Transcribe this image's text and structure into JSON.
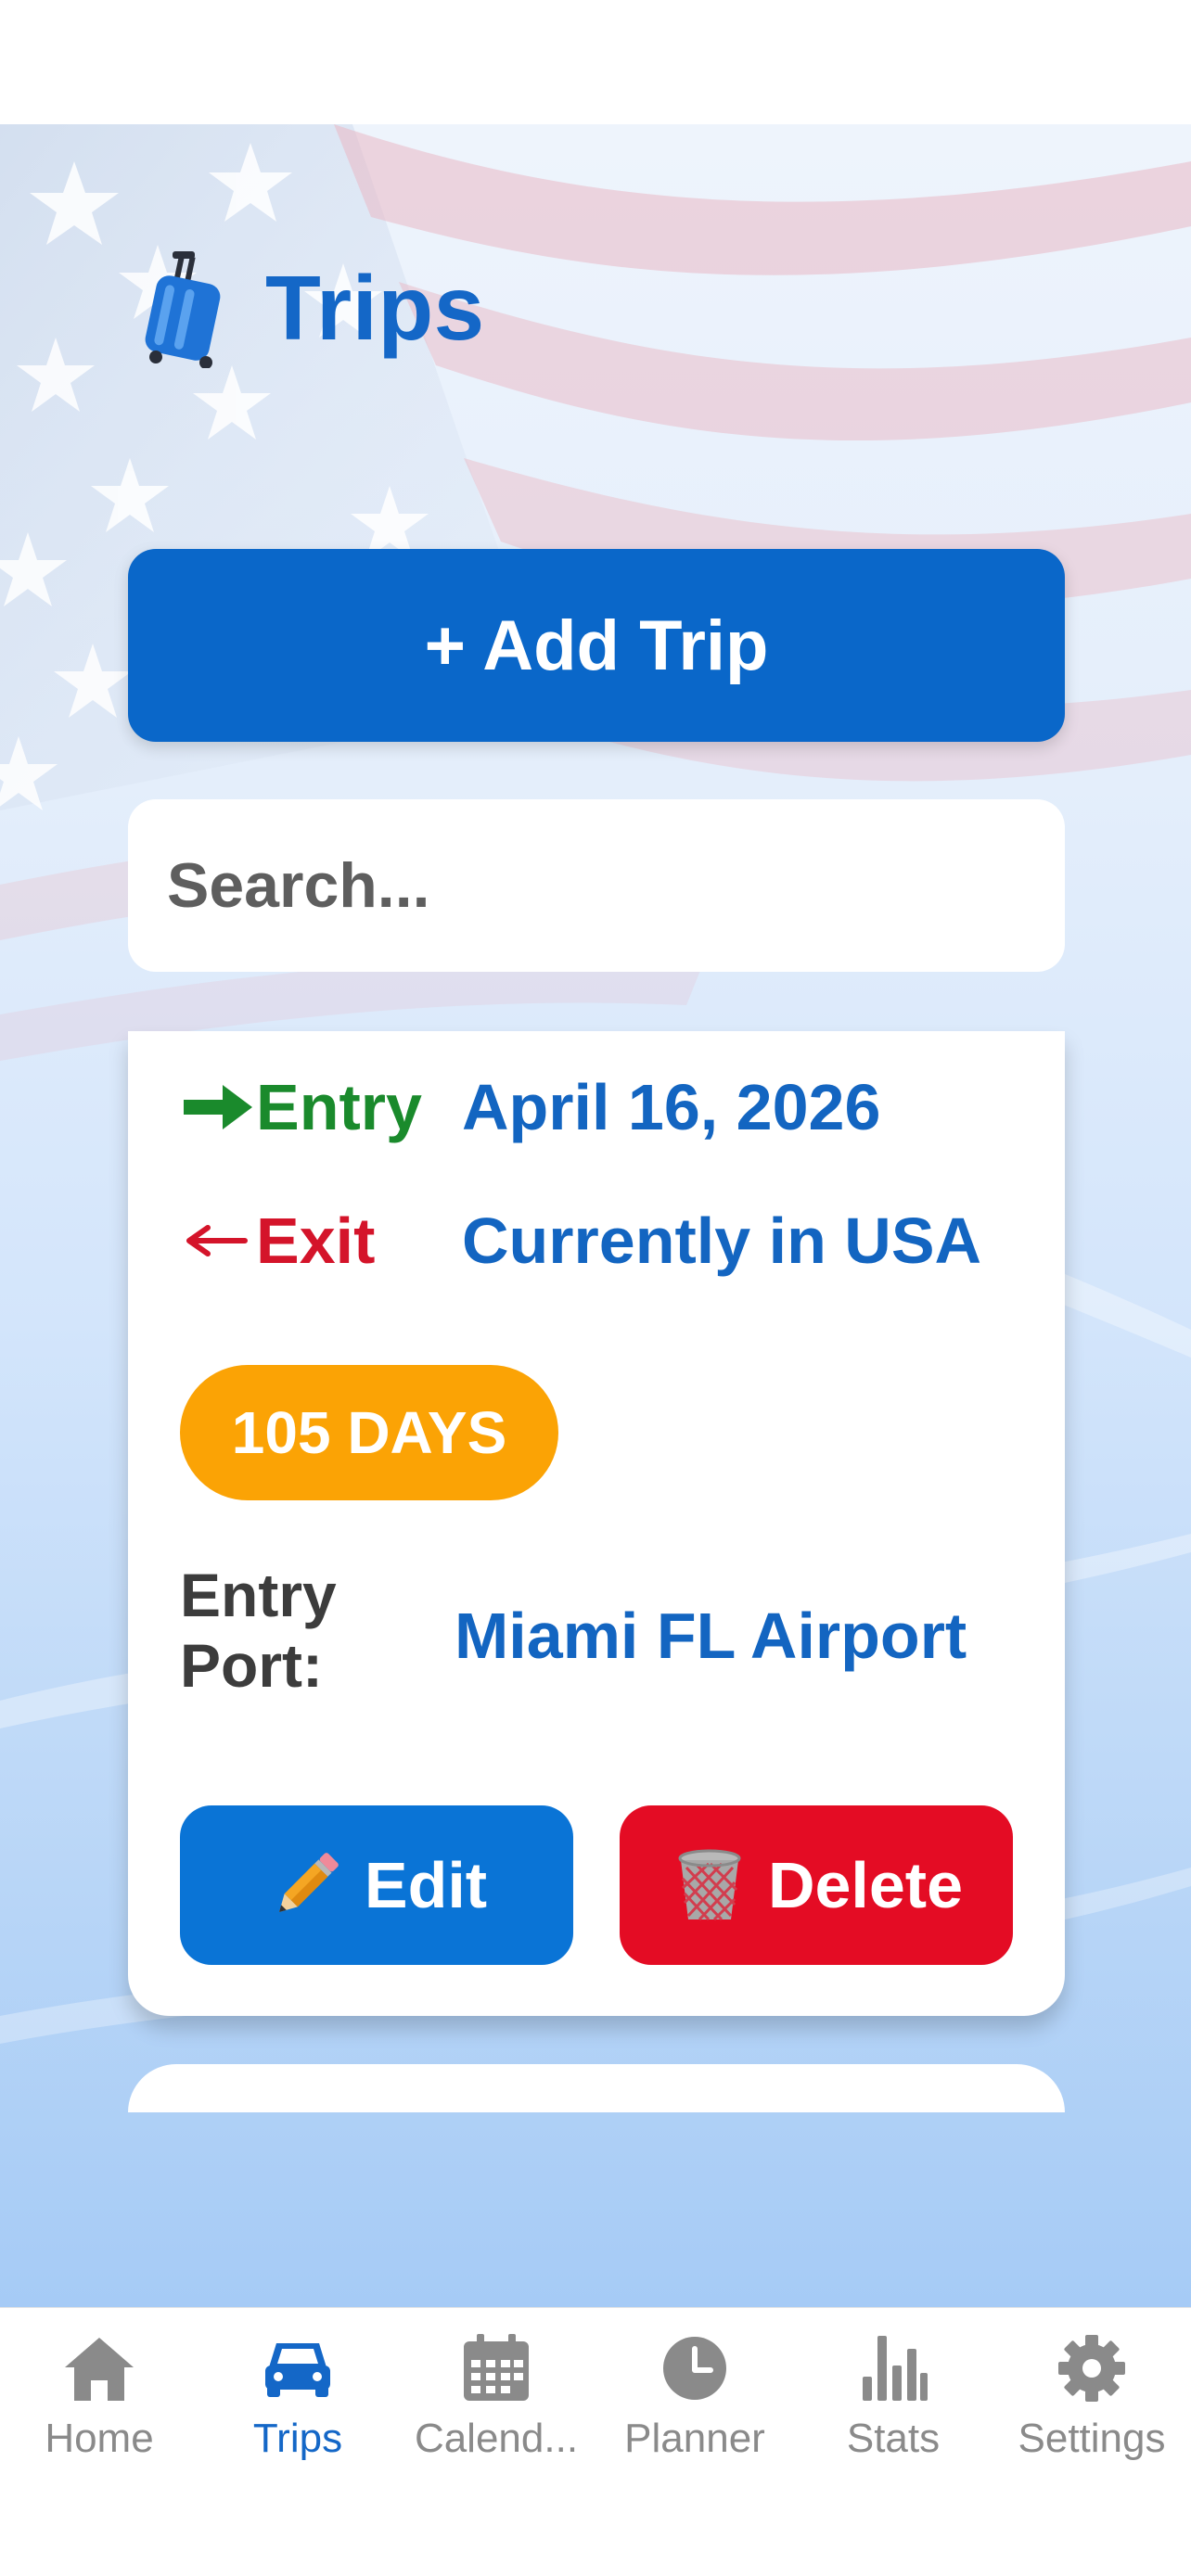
{
  "page": {
    "title": "Trips",
    "add_trip_label": "+ Add Trip",
    "search_placeholder": "Search..."
  },
  "trip": {
    "entry_label": "Entry",
    "entry_date": "April 16, 2026",
    "exit_label": "Exit",
    "exit_value": "Currently in USA",
    "days_badge": "105 DAYS",
    "port_label": "Entry Port:",
    "port_value": "Miami FL Airport",
    "edit_label": "Edit",
    "delete_label": "Delete"
  },
  "tabs": [
    {
      "label": "Home",
      "icon": "home-icon",
      "active": false
    },
    {
      "label": "Trips",
      "icon": "car-icon",
      "active": true
    },
    {
      "label": "Calend...",
      "icon": "calendar-icon",
      "active": false
    },
    {
      "label": "Planner",
      "icon": "clock-icon",
      "active": false
    },
    {
      "label": "Stats",
      "icon": "bar-chart-icon",
      "active": false
    },
    {
      "label": "Settings",
      "icon": "gear-icon",
      "active": false
    }
  ],
  "colors": {
    "primary": "#0a67c9",
    "title_blue": "#1467c7",
    "entry_green": "#1a8a2c",
    "exit_red": "#d4142a",
    "badge_orange": "#fba305",
    "delete_red": "#e40c24",
    "tab_inactive": "#8a8a8a"
  }
}
